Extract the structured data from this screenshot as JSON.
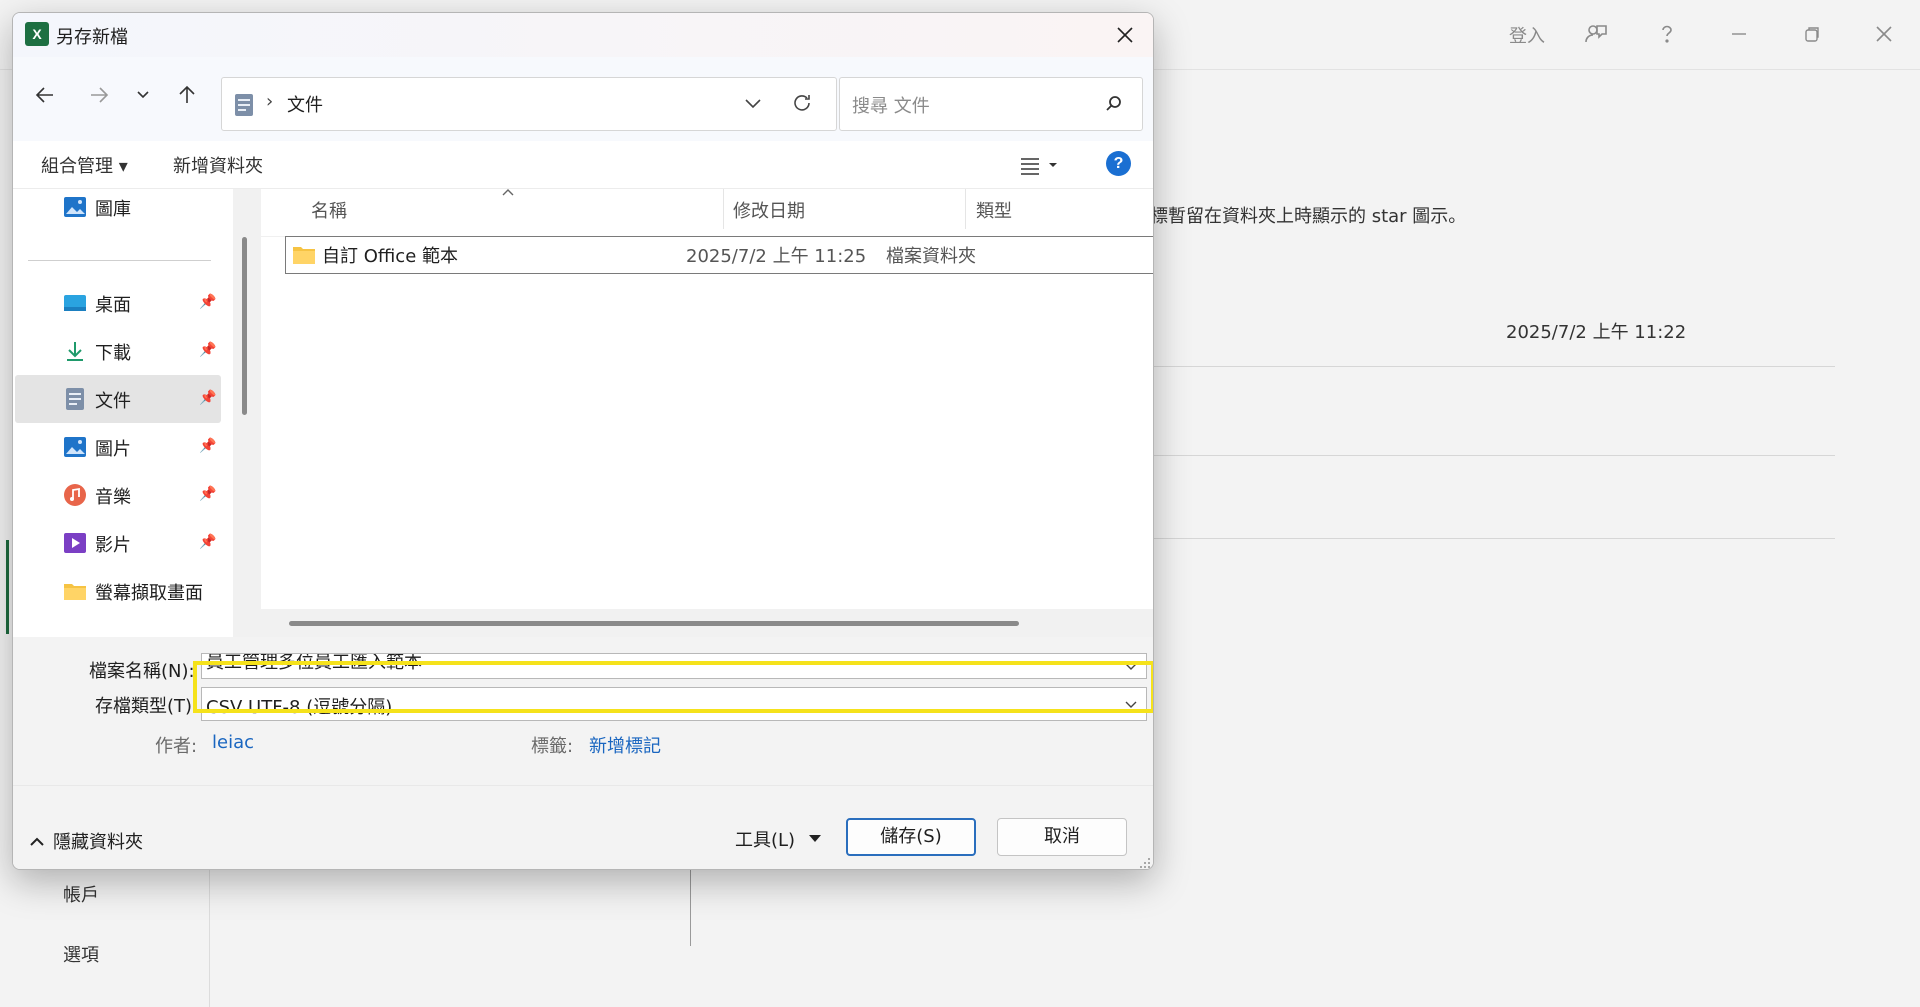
{
  "background": {
    "titlebar": {
      "signin": "登入"
    },
    "sidebar": {
      "items": [
        "帳戶",
        "選項"
      ]
    },
    "main": {
      "pin_hint": "標暫留在資料夾上時顯示的 star 圖示。",
      "date": "2025/7/2 上午 11:22"
    }
  },
  "dialog": {
    "title": "另存新檔",
    "address": {
      "separator": "›",
      "location": "文件"
    },
    "search": {
      "placeholder": "搜尋 文件"
    },
    "commands": {
      "organize": "組合管理 ▾",
      "new_folder": "新增資料夾"
    },
    "nav_pane": {
      "gallery": "圖庫",
      "items": [
        {
          "label": "桌面",
          "icon": "desktop-icon",
          "pinned": true
        },
        {
          "label": "下載",
          "icon": "download-icon",
          "pinned": true
        },
        {
          "label": "文件",
          "icon": "documents-icon",
          "pinned": true,
          "selected": true
        },
        {
          "label": "圖片",
          "icon": "pictures-icon",
          "pinned": true
        },
        {
          "label": "音樂",
          "icon": "music-icon",
          "pinned": true
        },
        {
          "label": "影片",
          "icon": "videos-icon",
          "pinned": true
        },
        {
          "label": "螢幕擷取畫面",
          "icon": "folder-icon",
          "pinned": false
        }
      ]
    },
    "columns": {
      "name": "名稱",
      "modified": "修改日期",
      "type": "類型"
    },
    "files": [
      {
        "name": "自訂 Office 範本",
        "modified": "2025/7/2 上午 11:25",
        "type": "檔案資料夾"
      }
    ],
    "fields": {
      "filename_label": "檔案名稱(N):",
      "filename_value": "員工管理多位員工匯入範本",
      "savetype_label": "存檔類型(T):",
      "savetype_value": "CSV UTF-8 (逗號分隔)",
      "author_label": "作者:",
      "author_value": "leiac",
      "tags_label": "標籤:",
      "tags_value": "新增標記"
    },
    "footer": {
      "hide_folders": "隱藏資料夾",
      "tools": "工具(L)",
      "save": "儲存(S)",
      "cancel": "取消"
    }
  },
  "colors": {
    "highlight": "#f5e21b",
    "link": "#1a66c0",
    "excel_green": "#1d6f42",
    "help_blue": "#1a6fd2"
  }
}
